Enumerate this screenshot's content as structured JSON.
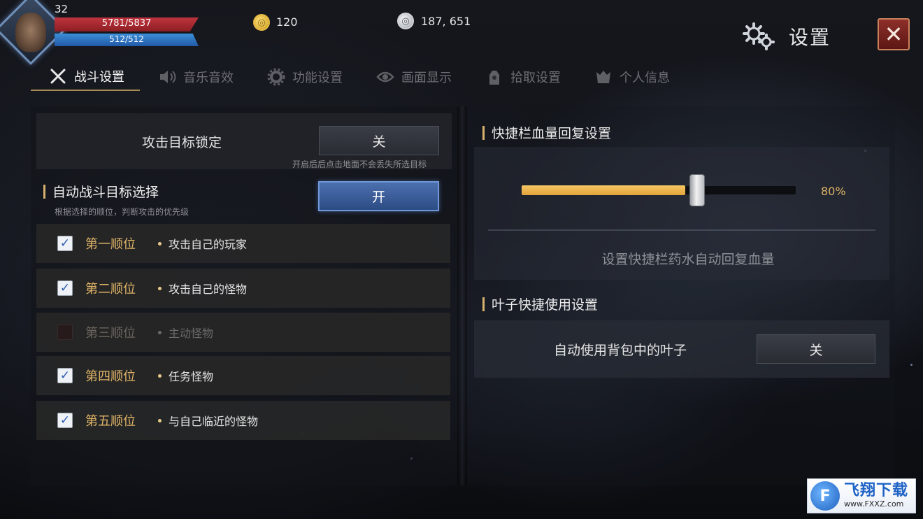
{
  "player": {
    "level": "32",
    "hp": "5781/5837",
    "hp_fraction": 0.99,
    "mp": "512/512",
    "mp_fraction": 1.0
  },
  "currency": {
    "gold": "120",
    "silver": "187, 651"
  },
  "header": {
    "title": "设置",
    "close_label": "✕"
  },
  "tabs": [
    {
      "label": "战斗设置",
      "icon": "crossed-swords-icon",
      "active": true
    },
    {
      "label": "音乐音效",
      "icon": "speaker-icon",
      "active": false
    },
    {
      "label": "功能设置",
      "icon": "gear-icon",
      "active": false
    },
    {
      "label": "画面显示",
      "icon": "eye-icon",
      "active": false
    },
    {
      "label": "拾取设置",
      "icon": "pickup-icon",
      "active": false
    },
    {
      "label": "个人信息",
      "icon": "helmet-icon",
      "active": false
    }
  ],
  "combat": {
    "target_lock": {
      "label": "攻击目标锁定",
      "button": "关",
      "hint": "开启后后点击地面不会丢失所选目标"
    },
    "auto_target": {
      "title": "自动战斗目标选择",
      "subtitle": "根据选择的顺位，判断攻击的优先级",
      "button": "开"
    },
    "priorities": [
      {
        "rank": "第一顺位",
        "target": "攻击自己的玩家",
        "checked": true
      },
      {
        "rank": "第二顺位",
        "target": "攻击自己的怪物",
        "checked": true
      },
      {
        "rank": "第三顺位",
        "target": "主动怪物",
        "checked": false
      },
      {
        "rank": "第四顺位",
        "target": "任务怪物",
        "checked": true
      },
      {
        "rank": "第五顺位",
        "target": "与自己临近的怪物",
        "checked": true
      }
    ]
  },
  "quickbar": {
    "title": "快捷栏血量回复设置",
    "value": 80,
    "value_label": "80%",
    "description": "设置快捷栏药水自动回复血量"
  },
  "leaf": {
    "title": "叶子快捷使用设置",
    "label": "自动使用背包中的叶子",
    "button": "关"
  },
  "watermark": {
    "logo_text": "F",
    "title": "飞翔下载",
    "url": "www.FXXZ.com"
  },
  "colors": {
    "accent_gold": "#e0b467",
    "button_on": "#3c5d99",
    "hp": "#c0343d",
    "mp": "#3c8ed8"
  }
}
